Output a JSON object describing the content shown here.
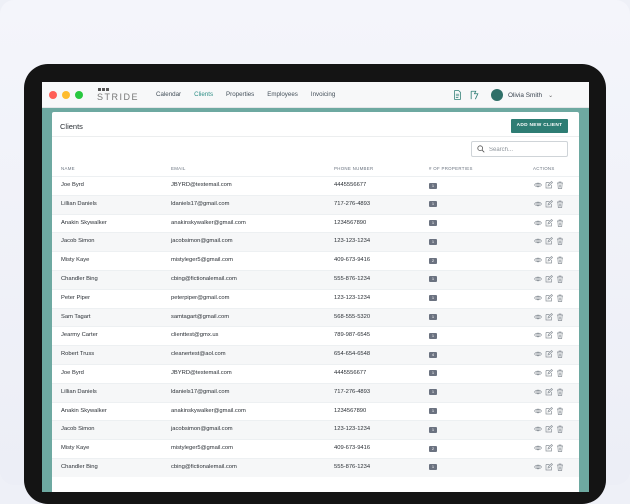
{
  "window": {
    "dot_colors": [
      "#ff5f57",
      "#febc2e",
      "#28c840"
    ]
  },
  "logo": {
    "text": "STRIDE"
  },
  "nav": {
    "items": [
      {
        "label": "Calendar",
        "active": false
      },
      {
        "label": "Clients",
        "active": true
      },
      {
        "label": "Properties",
        "active": false
      },
      {
        "label": "Employees",
        "active": false
      },
      {
        "label": "Invoicing",
        "active": false
      }
    ]
  },
  "user": {
    "name": "Olivia Smith"
  },
  "icons": {
    "doc": "document-icon",
    "map": "map-icon",
    "avatar": "avatar-icon",
    "chevron": "chevron-down-icon",
    "search": "search-icon",
    "view": "eye-icon",
    "edit": "edit-icon",
    "delete": "trash-icon"
  },
  "panel": {
    "title": "Clients",
    "add_button": "ADD NEW CLIENT",
    "search_placeholder": "Search...",
    "columns": {
      "name": "NAME",
      "email": "EMAIL",
      "phone": "PHONE NUMBER",
      "properties": "# OF PROPERTIES",
      "actions": "ACTIONS"
    }
  },
  "colors": {
    "accent": "#2e7d74",
    "screen_bg": "#6ea9a1",
    "badge": "#6b7280"
  },
  "clients": [
    {
      "name": "Joe Byrd",
      "email": "JBYRD@testemail.com",
      "phone": "4445556677",
      "properties": "1"
    },
    {
      "name": "Lillian Daniels",
      "email": "ldaniels17@gmail.com",
      "phone": "717-276-4893",
      "properties": "1"
    },
    {
      "name": "Anakin Skywalker",
      "email": "anakinskywalker@gmail.com",
      "phone": "1234567890",
      "properties": "1"
    },
    {
      "name": "Jacob Simon",
      "email": "jacobsimon@gmail.com",
      "phone": "123-123-1234",
      "properties": "1"
    },
    {
      "name": "Misty Kaye",
      "email": "mistyleger5@gmail.com",
      "phone": "409-673-9416",
      "properties": "2"
    },
    {
      "name": "Chandler Bing",
      "email": "cbing@fictionalemail.com",
      "phone": "555-876-1234",
      "properties": "1"
    },
    {
      "name": "Peter Piper",
      "email": "peterpiper@gmail.com",
      "phone": "123-123-1234",
      "properties": "1"
    },
    {
      "name": "Sam Tagart",
      "email": "samtagart@gmail.com",
      "phone": "568-555-5320",
      "properties": "1"
    },
    {
      "name": "Jearmy Carter",
      "email": "clienttest@gmx.us",
      "phone": "789-987-6545",
      "properties": "1"
    },
    {
      "name": "Robert Truss",
      "email": "cleanertest@aol.com",
      "phone": "654-654-6548",
      "properties": "4"
    },
    {
      "name": "Joe Byrd",
      "email": "JBYRD@testemail.com",
      "phone": "4445556677",
      "properties": "1"
    },
    {
      "name": "Lillian Daniels",
      "email": "ldaniels17@gmail.com",
      "phone": "717-276-4893",
      "properties": "1"
    },
    {
      "name": "Anakin Skywalker",
      "email": "anakinskywalker@gmail.com",
      "phone": "1234567890",
      "properties": "1"
    },
    {
      "name": "Jacob Simon",
      "email": "jacobsimon@gmail.com",
      "phone": "123-123-1234",
      "properties": "1"
    },
    {
      "name": "Misty Kaye",
      "email": "mistyleger5@gmail.com",
      "phone": "409-673-9416",
      "properties": "2"
    },
    {
      "name": "Chandler Bing",
      "email": "cbing@fictionalemail.com",
      "phone": "555-876-1234",
      "properties": "1"
    }
  ]
}
